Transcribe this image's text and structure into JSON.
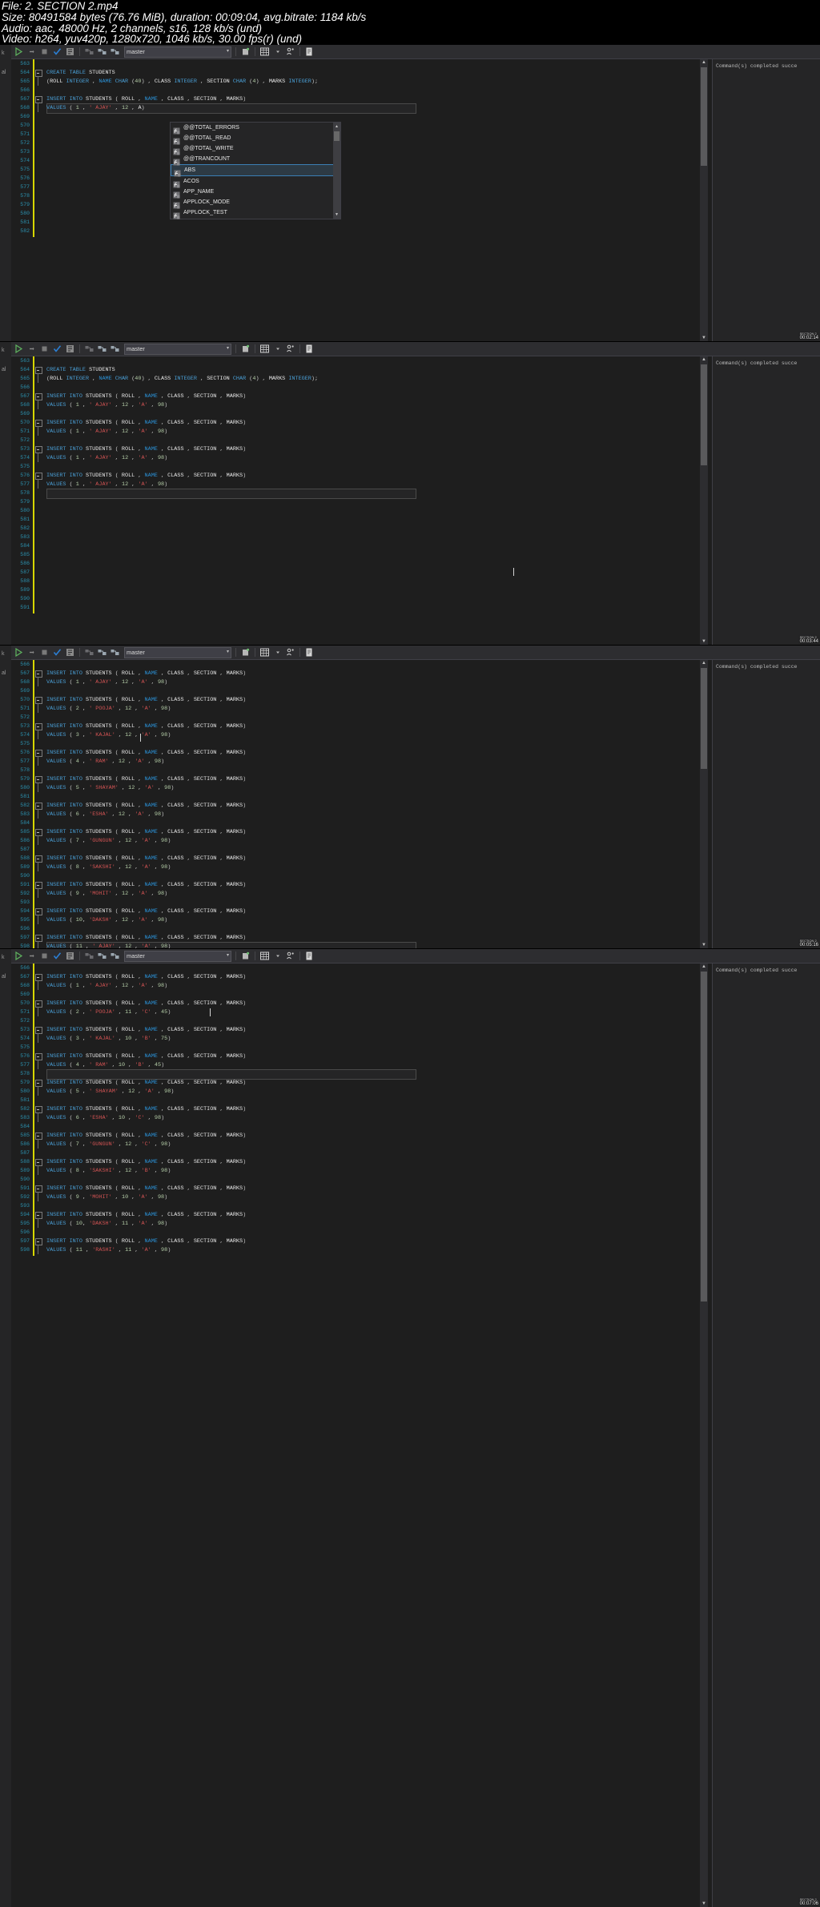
{
  "mediainfo": {
    "line1": "File: 2. SECTION 2.mp4",
    "line2": "Size: 80491584 bytes (76.76 MiB), duration: 00:09:04, avg.bitrate: 1184 kb/s",
    "line3": "Audio: aac, 48000 Hz, 2 channels, s16, 128 kb/s (und)",
    "line4": "Video: h264, yuv420p, 1280x720, 1046 kb/s, 30.00 fps(r) (und)"
  },
  "toolbar": {
    "database": "master",
    "icons": [
      "execute-icon",
      "debug-icon",
      "stop-icon",
      "parse-check-icon",
      "display-estimated-plan-icon",
      "include-actual-plan-icon",
      "include-client-statistics-icon",
      "include-live-plan-icon",
      "results-to-grid-icon",
      "results-to-text-icon",
      "results-to-file-icon",
      "comment-icon"
    ]
  },
  "autocomplete": {
    "items": [
      "@@TOTAL_ERRORS",
      "@@TOTAL_READ",
      "@@TOTAL_WRITE",
      "@@TRANCOUNT",
      "ABS",
      "ACOS",
      "APP_NAME",
      "APPLOCK_MODE",
      "APPLOCK_TEST"
    ],
    "selected": "ABS",
    "icon": "function-icon"
  },
  "results": {
    "message": "Command(s) completed succe"
  },
  "panels": [
    {
      "id": "panel-1",
      "timestamp": "00:02:14",
      "timestamp_label": "SECTION 2",
      "first_line_no": 563,
      "current_line": 568,
      "lines": [
        {
          "n": 563,
          "t": ""
        },
        {
          "n": 564,
          "t": "CREATE TABLE STUDENTS",
          "fold": true
        },
        {
          "n": 565,
          "t": "(ROLL INTEGER , NAME CHAR (40) , CLASS INTEGER , SECTION CHAR (4) , MARKS INTEGER);"
        },
        {
          "n": 566,
          "t": ""
        },
        {
          "n": 567,
          "t": "INSERT INTO STUDENTS ( ROLL , NAME , CLASS , SECTION , MARKS)",
          "fold": true
        },
        {
          "n": 568,
          "t": "VALUES ( 1 , ' AJAY' , 12 , A)"
        },
        {
          "n": 569,
          "t": ""
        },
        {
          "n": 570,
          "t": ""
        },
        {
          "n": 571,
          "t": ""
        },
        {
          "n": 572,
          "t": ""
        },
        {
          "n": 573,
          "t": ""
        },
        {
          "n": 574,
          "t": ""
        },
        {
          "n": 575,
          "t": ""
        },
        {
          "n": 576,
          "t": ""
        },
        {
          "n": 577,
          "t": ""
        },
        {
          "n": 578,
          "t": ""
        },
        {
          "n": 579,
          "t": ""
        },
        {
          "n": 580,
          "t": ""
        },
        {
          "n": 581,
          "t": ""
        },
        {
          "n": 582,
          "t": ""
        }
      ]
    },
    {
      "id": "panel-2",
      "timestamp": "00:03:44",
      "timestamp_label": "SECTION 2",
      "first_line_no": 563,
      "current_line": 578,
      "lines": [
        {
          "n": 563,
          "t": ""
        },
        {
          "n": 564,
          "t": "CREATE TABLE STUDENTS",
          "fold": true
        },
        {
          "n": 565,
          "t": "(ROLL INTEGER , NAME CHAR (40) , CLASS INTEGER , SECTION CHAR (4) , MARKS INTEGER);"
        },
        {
          "n": 566,
          "t": ""
        },
        {
          "n": 567,
          "t": "INSERT INTO STUDENTS ( ROLL , NAME , CLASS , SECTION , MARKS)",
          "fold": true
        },
        {
          "n": 568,
          "t": "VALUES ( 1 , ' AJAY' , 12 , 'A' , 98)"
        },
        {
          "n": 569,
          "t": ""
        },
        {
          "n": 570,
          "t": "INSERT INTO STUDENTS ( ROLL , NAME , CLASS , SECTION , MARKS)",
          "fold": true
        },
        {
          "n": 571,
          "t": "VALUES ( 1 , ' AJAY' , 12 , 'A' , 98)"
        },
        {
          "n": 572,
          "t": ""
        },
        {
          "n": 573,
          "t": "INSERT INTO STUDENTS ( ROLL , NAME , CLASS , SECTION , MARKS)",
          "fold": true
        },
        {
          "n": 574,
          "t": "VALUES ( 1 , ' AJAY' , 12 , 'A' , 98)"
        },
        {
          "n": 575,
          "t": ""
        },
        {
          "n": 576,
          "t": "INSERT INTO STUDENTS ( ROLL , NAME , CLASS , SECTION , MARKS)",
          "fold": true
        },
        {
          "n": 577,
          "t": "VALUES ( 1 , ' AJAY' , 12 , 'A' , 98)"
        },
        {
          "n": 578,
          "t": ""
        },
        {
          "n": 579,
          "t": ""
        },
        {
          "n": 580,
          "t": ""
        },
        {
          "n": 581,
          "t": ""
        },
        {
          "n": 582,
          "t": ""
        },
        {
          "n": 583,
          "t": ""
        },
        {
          "n": 584,
          "t": ""
        },
        {
          "n": 585,
          "t": ""
        },
        {
          "n": 586,
          "t": ""
        },
        {
          "n": 587,
          "t": ""
        },
        {
          "n": 588,
          "t": ""
        },
        {
          "n": 589,
          "t": ""
        },
        {
          "n": 590,
          "t": ""
        },
        {
          "n": 591,
          "t": ""
        }
      ]
    },
    {
      "id": "panel-3",
      "timestamp": "00:05:16",
      "timestamp_label": "SECTION 2",
      "first_line_no": 566,
      "current_line": 598,
      "lines": [
        {
          "n": 566,
          "t": ""
        },
        {
          "n": 567,
          "t": "INSERT INTO STUDENTS ( ROLL , NAME , CLASS , SECTION , MARKS)",
          "fold": true
        },
        {
          "n": 568,
          "t": "VALUES ( 1 , ' AJAY' , 12 , 'A' , 98)"
        },
        {
          "n": 569,
          "t": ""
        },
        {
          "n": 570,
          "t": "INSERT INTO STUDENTS ( ROLL , NAME , CLASS , SECTION , MARKS)",
          "fold": true
        },
        {
          "n": 571,
          "t": "VALUES ( 2 , ' POOJA' , 12 , 'A' , 98)"
        },
        {
          "n": 572,
          "t": ""
        },
        {
          "n": 573,
          "t": "INSERT INTO STUDENTS ( ROLL , NAME , CLASS , SECTION , MARKS)",
          "fold": true
        },
        {
          "n": 574,
          "t": "VALUES ( 3 , ' KAJAL' , 12 , 'A' , 98)"
        },
        {
          "n": 575,
          "t": ""
        },
        {
          "n": 576,
          "t": "INSERT INTO STUDENTS ( ROLL , NAME , CLASS , SECTION , MARKS)",
          "fold": true
        },
        {
          "n": 577,
          "t": "VALUES ( 4 , ' RAM' , 12 , 'A' , 98)"
        },
        {
          "n": 578,
          "t": ""
        },
        {
          "n": 579,
          "t": "INSERT INTO STUDENTS ( ROLL , NAME , CLASS , SECTION , MARKS)",
          "fold": true
        },
        {
          "n": 580,
          "t": "VALUES ( 5 , ' SHAYAM' , 12 , 'A' , 98)"
        },
        {
          "n": 581,
          "t": ""
        },
        {
          "n": 582,
          "t": "INSERT INTO STUDENTS ( ROLL , NAME , CLASS , SECTION , MARKS)",
          "fold": true
        },
        {
          "n": 583,
          "t": "VALUES ( 6 , 'ESHA' , 12 , 'A' , 98)"
        },
        {
          "n": 584,
          "t": ""
        },
        {
          "n": 585,
          "t": "INSERT INTO STUDENTS ( ROLL , NAME , CLASS , SECTION , MARKS)",
          "fold": true
        },
        {
          "n": 586,
          "t": "VALUES ( 7 , 'GUNGUN' , 12 , 'A' , 98)"
        },
        {
          "n": 587,
          "t": ""
        },
        {
          "n": 588,
          "t": "INSERT INTO STUDENTS ( ROLL , NAME , CLASS , SECTION , MARKS)",
          "fold": true
        },
        {
          "n": 589,
          "t": "VALUES ( 8 , 'SAKSHI' , 12 , 'A' , 98)"
        },
        {
          "n": 590,
          "t": ""
        },
        {
          "n": 591,
          "t": "INSERT INTO STUDENTS ( ROLL , NAME , CLASS , SECTION , MARKS)",
          "fold": true
        },
        {
          "n": 592,
          "t": "VALUES ( 9 , 'MOHIT' , 12 , 'A' , 98)"
        },
        {
          "n": 593,
          "t": ""
        },
        {
          "n": 594,
          "t": "INSERT INTO STUDENTS ( ROLL , NAME , CLASS , SECTION , MARKS)",
          "fold": true
        },
        {
          "n": 595,
          "t": "VALUES ( 10, 'DAKSH' , 12 , 'A' , 98)"
        },
        {
          "n": 596,
          "t": ""
        },
        {
          "n": 597,
          "t": "INSERT INTO STUDENTS ( ROLL , NAME , CLASS , SECTION , MARKS)",
          "fold": true
        },
        {
          "n": 598,
          "t": "VALUES ( 11 , ' AJAY' , 12 , 'A' , 98)"
        }
      ]
    },
    {
      "id": "panel-4",
      "timestamp": "00:07:06",
      "timestamp_label": "SECTION 2",
      "first_line_no": 566,
      "current_line": 578,
      "lines": [
        {
          "n": 566,
          "t": ""
        },
        {
          "n": 567,
          "t": "INSERT INTO STUDENTS ( ROLL , NAME , CLASS , SECTION , MARKS)",
          "fold": true
        },
        {
          "n": 568,
          "t": "VALUES ( 1 , ' AJAY' , 12 , 'A' , 98)"
        },
        {
          "n": 569,
          "t": ""
        },
        {
          "n": 570,
          "t": "INSERT INTO STUDENTS ( ROLL , NAME , CLASS , SECTION , MARKS)",
          "fold": true
        },
        {
          "n": 571,
          "t": "VALUES ( 2 , ' POOJA' , 11 , 'C' , 45)"
        },
        {
          "n": 572,
          "t": ""
        },
        {
          "n": 573,
          "t": "INSERT INTO STUDENTS ( ROLL , NAME , CLASS , SECTION , MARKS)",
          "fold": true
        },
        {
          "n": 574,
          "t": "VALUES ( 3 , ' KAJAL' , 10 , 'B' , 75)"
        },
        {
          "n": 575,
          "t": ""
        },
        {
          "n": 576,
          "t": "INSERT INTO STUDENTS ( ROLL , NAME , CLASS , SECTION , MARKS)",
          "fold": true
        },
        {
          "n": 577,
          "t": "VALUES ( 4 , ' RAM' , 10 , 'B' , 45)"
        },
        {
          "n": 578,
          "t": ""
        },
        {
          "n": 579,
          "t": "INSERT INTO STUDENTS ( ROLL , NAME , CLASS , SECTION , MARKS)",
          "fold": true
        },
        {
          "n": 580,
          "t": "VALUES ( 5 , ' SHAYAM' , 12 , 'A' , 98)"
        },
        {
          "n": 581,
          "t": ""
        },
        {
          "n": 582,
          "t": "INSERT INTO STUDENTS ( ROLL , NAME , CLASS , SECTION , MARKS)",
          "fold": true
        },
        {
          "n": 583,
          "t": "VALUES ( 6 , 'ESHA' , 10 , 'C' , 98)"
        },
        {
          "n": 584,
          "t": ""
        },
        {
          "n": 585,
          "t": "INSERT INTO STUDENTS ( ROLL , NAME , CLASS , SECTION , MARKS)",
          "fold": true
        },
        {
          "n": 586,
          "t": "VALUES ( 7 , 'GUNGUN' , 12 , 'C' , 98)"
        },
        {
          "n": 587,
          "t": ""
        },
        {
          "n": 588,
          "t": "INSERT INTO STUDENTS ( ROLL , NAME , CLASS , SECTION , MARKS)",
          "fold": true
        },
        {
          "n": 589,
          "t": "VALUES ( 8 , 'SAKSHI' , 12 , 'B' , 98)"
        },
        {
          "n": 590,
          "t": ""
        },
        {
          "n": 591,
          "t": "INSERT INTO STUDENTS ( ROLL , NAME , CLASS , SECTION , MARKS)",
          "fold": true
        },
        {
          "n": 592,
          "t": "VALUES ( 9 , 'MOHIT' , 10 , 'A' , 98)"
        },
        {
          "n": 593,
          "t": ""
        },
        {
          "n": 594,
          "t": "INSERT INTO STUDENTS ( ROLL , NAME , CLASS , SECTION , MARKS)",
          "fold": true
        },
        {
          "n": 595,
          "t": "VALUES ( 10, 'DAKSH' , 11 , 'A' , 98)"
        },
        {
          "n": 596,
          "t": ""
        },
        {
          "n": 597,
          "t": "INSERT INTO STUDENTS ( ROLL , NAME , CLASS , SECTION , MARKS)",
          "fold": true
        },
        {
          "n": 598,
          "t": "VALUES ( 11 , 'RASHI' , 11 , 'A' , 98)"
        }
      ]
    }
  ],
  "colors": {
    "editor_bg": "#1e1e1e",
    "toolbar_bg": "#2d2d30",
    "keyword": "#4a9fd6",
    "string": "#d15353",
    "number": "#b5cea8",
    "linenumber": "#2b91af",
    "selection_border": "#3b7fb5"
  }
}
